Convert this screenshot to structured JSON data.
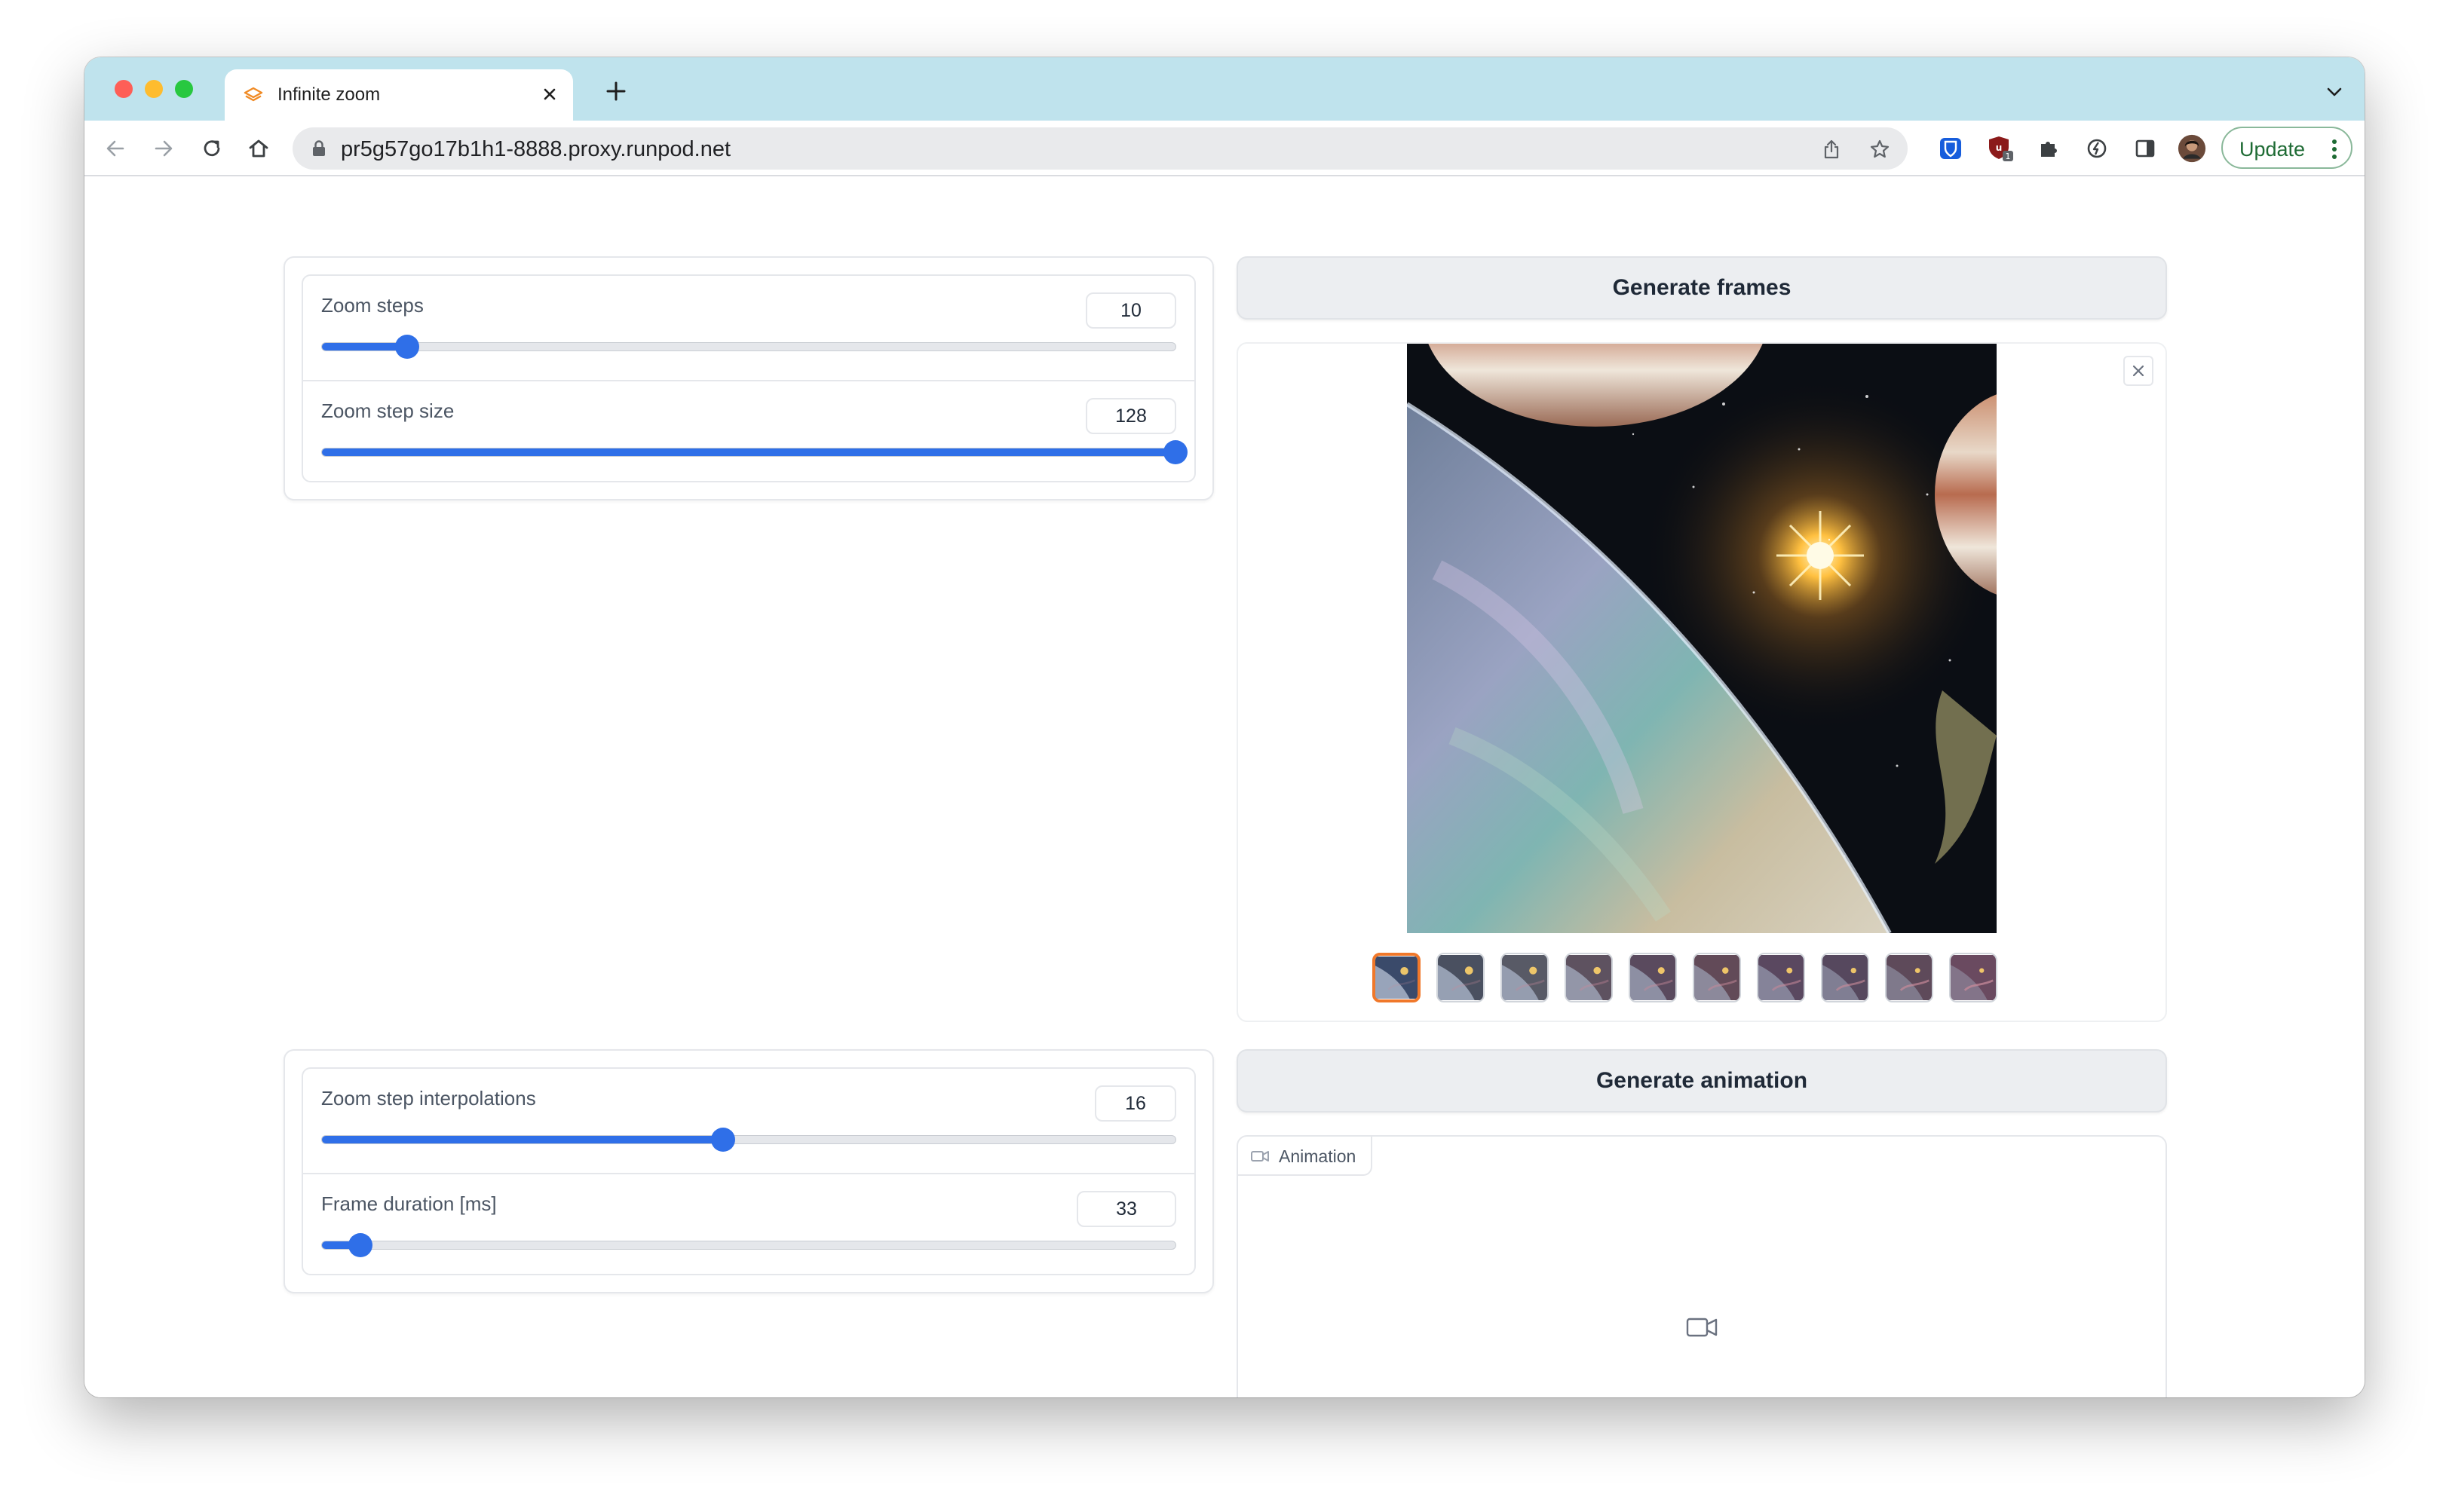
{
  "browser": {
    "tab_title": "Infinite zoom",
    "url": "pr5g57go17b1h1-8888.proxy.runpod.net",
    "update_label": "Update",
    "extension_badge": "1"
  },
  "left_panel_top": {
    "sliders": [
      {
        "label": "Zoom steps",
        "value": "10",
        "fraction": 0.1
      },
      {
        "label": "Zoom step size",
        "value": "128",
        "fraction": 1.0
      }
    ]
  },
  "left_panel_bottom": {
    "sliders": [
      {
        "label": "Zoom step interpolations",
        "value": "16",
        "fraction": 0.47
      },
      {
        "label": "Frame duration [ms]",
        "value": "33",
        "fraction": 0.045
      }
    ]
  },
  "right": {
    "generate_frames_label": "Generate frames",
    "generate_animation_label": "Generate animation",
    "animation_label": "Animation",
    "gallery_count": 10,
    "selected_index": 0
  },
  "colors": {
    "accent": "#2f6fe8",
    "selected_thumb": "#f0782a",
    "tab_strip": "#bfe3ed",
    "update_border": "#8ab89a"
  },
  "icons": {
    "tab_favicon": "layers-icon",
    "back": "back-arrow-icon",
    "forward": "forward-arrow-icon",
    "reload": "reload-icon",
    "home": "home-icon",
    "share": "share-icon",
    "bookmark": "star-icon",
    "extensions": [
      "bitwarden-icon",
      "ublock-icon",
      "puzzle-icon",
      "extension-icon",
      "side-panel-icon",
      "avatar"
    ],
    "close": "close-icon",
    "video": "video-camera-icon"
  }
}
